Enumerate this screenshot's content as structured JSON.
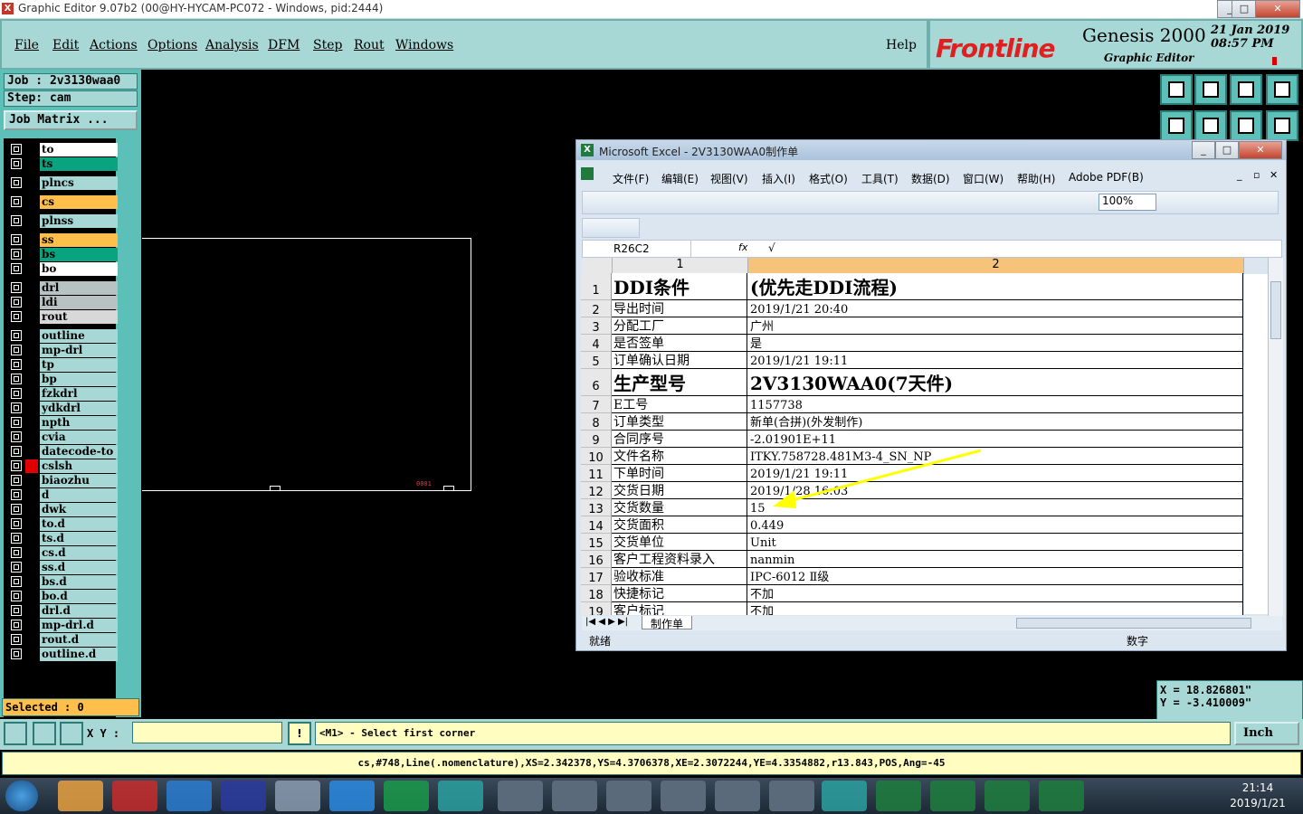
{
  "window": {
    "title": "Graphic Editor 9.07b2 (00@HY-HYCAM-PC072 - Windows, pid:2444)",
    "min": "_",
    "max": "□",
    "close": "✕"
  },
  "menu": {
    "items": [
      "File",
      "Edit",
      "Actions",
      "Options",
      "Analysis",
      "DFM",
      "Step",
      "Rout",
      "Windows"
    ],
    "help": "Help"
  },
  "brand": {
    "logo": "Frontline",
    "product": "Genesis 2000",
    "subtitle": "Graphic Editor",
    "date": "21 Jan 2019",
    "time": "08:57 PM"
  },
  "job": {
    "job_label": "Job : 2v3130waa0",
    "step_label": "Step: cam",
    "matrix_button": "Job Matrix ..."
  },
  "layers": [
    {
      "name": "to",
      "color": "#ffffff"
    },
    {
      "name": "ts",
      "color": "#0aa37f"
    },
    {
      "name": "plncs",
      "color": "#a7d8d6"
    },
    {
      "name": "cs",
      "color": "#ffbf4a"
    },
    {
      "name": "plnss",
      "color": "#a7d8d6"
    },
    {
      "name": "ss",
      "color": "#ffbf4a"
    },
    {
      "name": "bs",
      "color": "#0aa37f"
    },
    {
      "name": "bo",
      "color": "#ffffff"
    },
    {
      "name": "drl",
      "color": "#b8c2c2"
    },
    {
      "name": "ldi",
      "color": "#b8c2c2"
    },
    {
      "name": "rout",
      "color": "#d8d8d8"
    },
    {
      "name": "outline",
      "color": "#a7d8d6"
    },
    {
      "name": "mp-drl",
      "color": "#a7d8d6"
    },
    {
      "name": "tp",
      "color": "#a7d8d6"
    },
    {
      "name": "bp",
      "color": "#a7d8d6"
    },
    {
      "name": "fzkdrl",
      "color": "#a7d8d6"
    },
    {
      "name": "ydkdrl",
      "color": "#a7d8d6"
    },
    {
      "name": "npth",
      "color": "#a7d8d6"
    },
    {
      "name": "cvia",
      "color": "#a7d8d6"
    },
    {
      "name": "datecode-to",
      "color": "#a7d8d6"
    },
    {
      "name": "cslsh",
      "color": "#a7d8d6"
    },
    {
      "name": "biaozhu",
      "color": "#a7d8d6"
    },
    {
      "name": "d",
      "color": "#a7d8d6"
    },
    {
      "name": "dwk",
      "color": "#a7d8d6"
    },
    {
      "name": "to.d",
      "color": "#a7d8d6"
    },
    {
      "name": "ts.d",
      "color": "#a7d8d6"
    },
    {
      "name": "cs.d",
      "color": "#a7d8d6"
    },
    {
      "name": "ss.d",
      "color": "#a7d8d6"
    },
    {
      "name": "bs.d",
      "color": "#a7d8d6"
    },
    {
      "name": "bo.d",
      "color": "#a7d8d6"
    },
    {
      "name": "drl.d",
      "color": "#a7d8d6"
    },
    {
      "name": "mp-drl.d",
      "color": "#a7d8d6"
    },
    {
      "name": "rout.d",
      "color": "#a7d8d6"
    },
    {
      "name": "outline.d",
      "color": "#a7d8d6"
    }
  ],
  "selected": "Selected : 0",
  "coords": {
    "x": "X  =  18.826801\"",
    "y": "Y  =  -3.410009\""
  },
  "units": "Inch",
  "xy_label": "X Y :",
  "prompt": "<M1> - Select first corner",
  "info": "cs,#748,Line(.nomenclature),XS=2.342378,YS=4.3706378,XE=2.3072244,YE=4.3354882,r13.843,POS,Ang=-45",
  "canvas_label": "0001",
  "excel": {
    "title": "Microsoft Excel - 2V3130WAA0制作单",
    "menus": [
      "文件(F)",
      "编辑(E)",
      "视图(V)",
      "插入(I)",
      "格式(O)",
      "工具(T)",
      "数据(D)",
      "窗口(W)",
      "帮助(H)",
      "Adobe PDF(B)"
    ],
    "zoom": "100%",
    "namebox": "R26C2",
    "fx": "fx",
    "formula": "√",
    "col1": "1",
    "col2": "2",
    "rows": [
      {
        "n": "1",
        "a": "DDI条件",
        "b": "(优先走DDI流程)",
        "big": true
      },
      {
        "n": "2",
        "a": "导出时间",
        "b": "2019/1/21 20:40"
      },
      {
        "n": "3",
        "a": "分配工厂",
        "b": "广州"
      },
      {
        "n": "4",
        "a": "是否签单",
        "b": "是"
      },
      {
        "n": "5",
        "a": "订单确认日期",
        "b": "2019/1/21 19:11"
      },
      {
        "n": "6",
        "a": "生产型号",
        "b": "2V3130WAA0(7天件)",
        "big": true
      },
      {
        "n": "7",
        "a": "E工号",
        "b": "1157738"
      },
      {
        "n": "8",
        "a": "订单类型",
        "b": "新单(合拼)(外发制作)"
      },
      {
        "n": "9",
        "a": "合同序号",
        "b": "-2.01901E+11"
      },
      {
        "n": "10",
        "a": "文件名称",
        "b": "ITKY.758728.481M3-4_SN_NP"
      },
      {
        "n": "11",
        "a": "下单时间",
        "b": "2019/1/21 19:11"
      },
      {
        "n": "12",
        "a": "交货日期",
        "b": "2019/1/28 16:03"
      },
      {
        "n": "13",
        "a": "交货数量",
        "b": "15"
      },
      {
        "n": "14",
        "a": "交货面积",
        "b": "0.449"
      },
      {
        "n": "15",
        "a": "交货单位",
        "b": "Unit"
      },
      {
        "n": "16",
        "a": "客户工程资料录入",
        "b": "nanmin"
      },
      {
        "n": "17",
        "a": "验收标准",
        "b": "IPC-6012 Ⅱ级"
      },
      {
        "n": "18",
        "a": "快捷标记",
        "b": "不加"
      },
      {
        "n": "19",
        "a": "客户标记",
        "b": "不加"
      }
    ],
    "sheet_tab": "制作单",
    "status_ready": "就绪",
    "status_num": "数字"
  },
  "taskbar": {
    "time": "21:14",
    "date": "2019/1/21"
  }
}
